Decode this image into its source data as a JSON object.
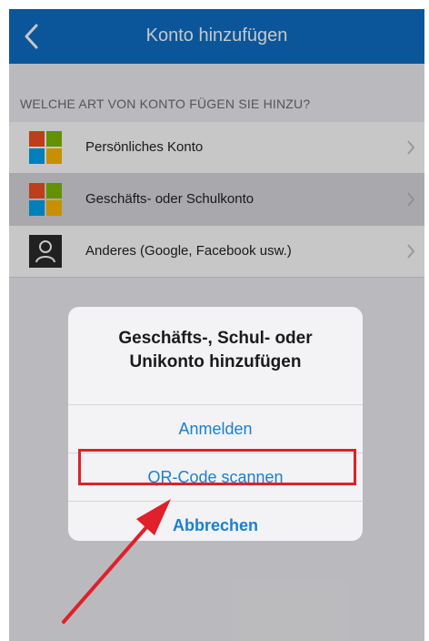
{
  "navbar": {
    "title": "Konto hinzufügen"
  },
  "section": {
    "header": "WELCHE ART VON KONTO FÜGEN SIE HINZU?"
  },
  "accounts": [
    {
      "label": "Persönliches Konto",
      "icon": "microsoft-logo-icon"
    },
    {
      "label": "Geschäfts- oder Schulkonto",
      "icon": "microsoft-logo-icon"
    },
    {
      "label": "Anderes (Google, Facebook usw.)",
      "icon": "person-icon"
    }
  ],
  "dialog": {
    "title": "Geschäfts-, Schul- oder\nUnikonto hinzufügen",
    "sign_in": "Anmelden",
    "scan_qr": "QR-Code scannen",
    "cancel": "Abbrechen"
  },
  "colors": {
    "navbar": "#0f6fc6",
    "link": "#1a7fd4",
    "highlight": "#e0202a"
  }
}
